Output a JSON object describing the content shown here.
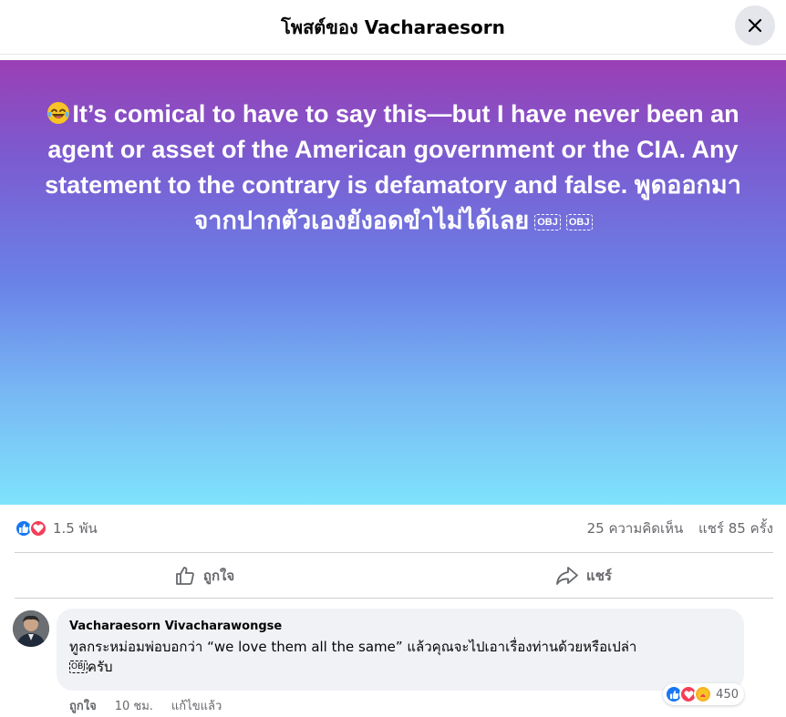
{
  "header": {
    "title": "โพสต์ของ Vacharaesorn",
    "close_icon": "close-icon"
  },
  "post": {
    "text": "It’s comical to have to say this—but I have never been an agent or asset of the American government or the CIA. Any statement to the contrary is defamatory and false. พูดออกมาจากปากตัวเองยังอดขำไม่ได้เลย",
    "obj1": "OBJ",
    "obj2": "OBJ",
    "gradient_top": "#9b3fb5",
    "gradient_bottom": "#7fe3fb"
  },
  "stats": {
    "reactions": "1.5 พัน",
    "comments": "25 ความคิดเห็น",
    "shares": "แชร์ 85 ครั้ง"
  },
  "actions": {
    "like": "ถูกใจ",
    "share": "แชร์"
  },
  "comment": {
    "author": "Vacharaesorn Vivacharawongse",
    "line1": "ทูลกระหม่อมพ่อบอกว่า “we love them all the same” แล้วคุณจะไปเอาเรื่องท่านด้วยหรือเปล่า",
    "obj": "OBJ",
    "line2": "ครับ",
    "reaction_count": "450",
    "like": "ถูกใจ",
    "time": "10 ชม.",
    "edited": "แก้ไขแล้ว"
  },
  "colors": {
    "like_blue": "#1877f2",
    "love_red": "#f33e58",
    "care_yellow": "#f7b125"
  }
}
